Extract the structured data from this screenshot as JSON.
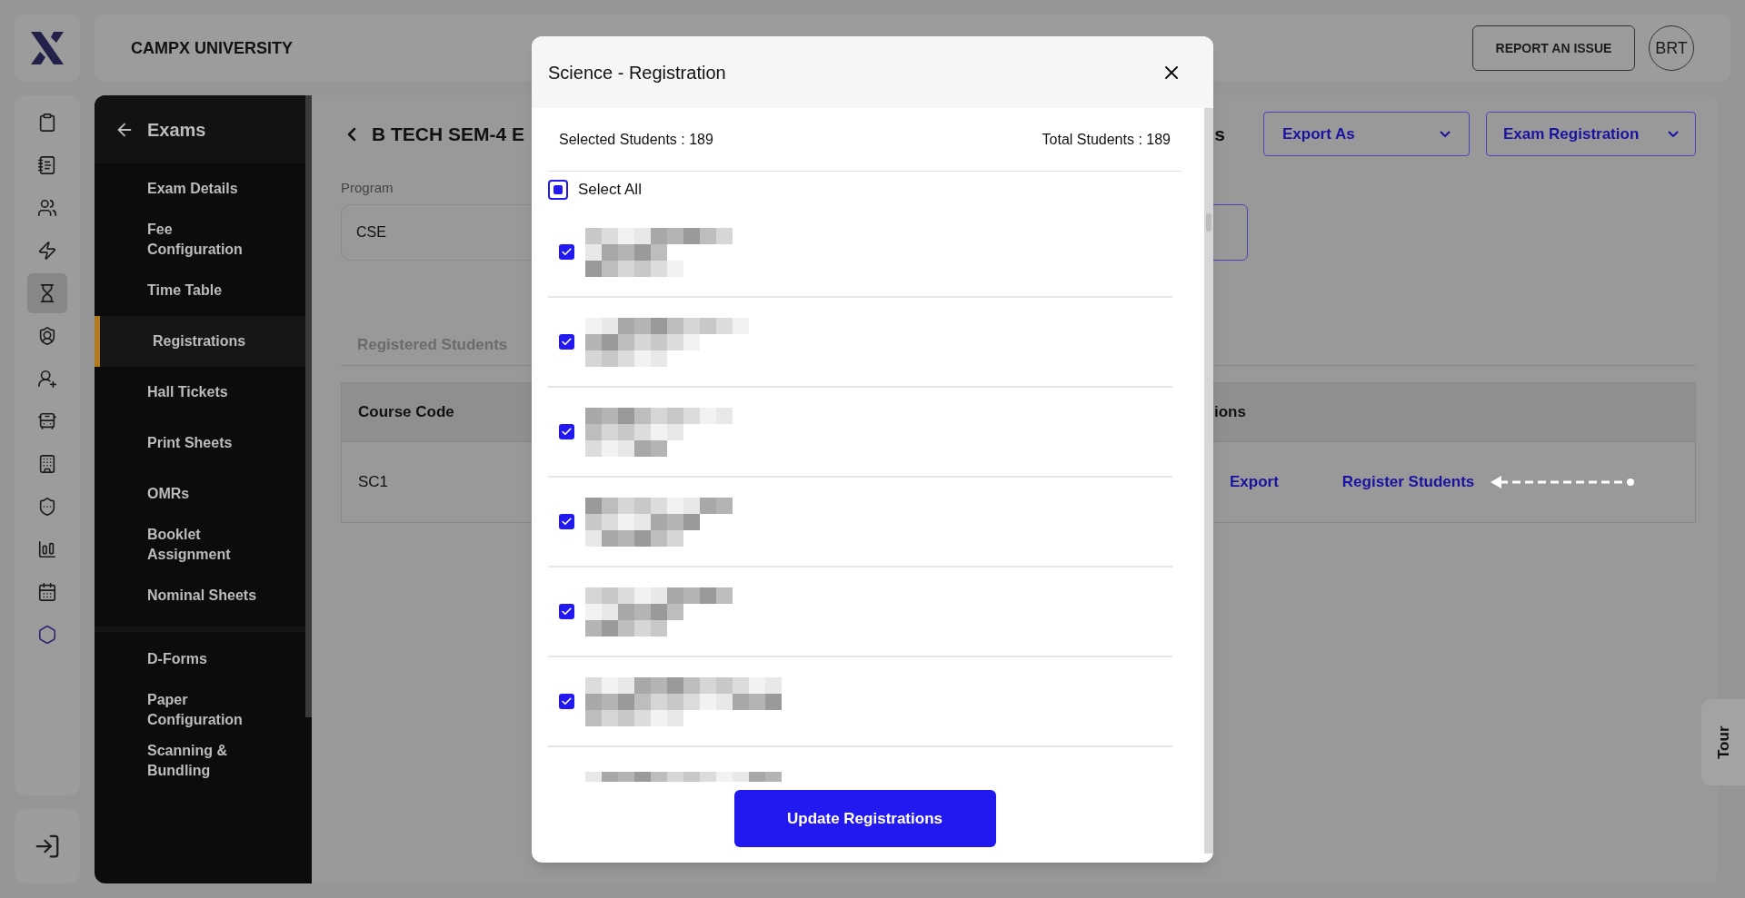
{
  "app": {
    "university": "CAMPX UNIVERSITY",
    "report_button": "REPORT AN ISSUE",
    "avatar": "BRT"
  },
  "rail": [
    {
      "selected": false,
      "color": "#1c1c1c"
    },
    {
      "selected": false,
      "color": "#1c1c1c"
    },
    {
      "selected": false,
      "color": "#1c1c1c"
    },
    {
      "selected": false,
      "color": "#1c1c1c"
    },
    {
      "selected": true,
      "color": "#1c1c1c"
    },
    {
      "selected": false,
      "color": "#1c1c1c"
    },
    {
      "selected": false,
      "color": "#1c1c1c"
    },
    {
      "selected": false,
      "color": "#1c1c1c"
    },
    {
      "selected": false,
      "color": "#1c1c1c"
    },
    {
      "selected": false,
      "color": "#1c1c1c"
    },
    {
      "selected": false,
      "color": "#1c1c1c"
    },
    {
      "selected": false,
      "color": "#1c1c1c"
    },
    {
      "selected": false,
      "color": "#2e2a6e"
    }
  ],
  "sidebar": {
    "title": "Exams",
    "sections": [
      {
        "items": [
          {
            "label": "Exam Details",
            "selected": false
          },
          {
            "label": "Fee Configuration",
            "selected": false
          },
          {
            "label": "Time Table",
            "selected": false
          },
          {
            "label": "Registrations",
            "selected": true
          },
          {
            "label": "Hall Tickets",
            "selected": false
          },
          {
            "label": "Print Sheets",
            "selected": false
          },
          {
            "label": "OMRs",
            "selected": false
          },
          {
            "label": "Booklet Assignment",
            "selected": false
          },
          {
            "label": "Nominal Sheets",
            "selected": false
          }
        ]
      },
      {
        "items": [
          {
            "label": "D-Forms",
            "selected": false
          },
          {
            "label": "Paper Configuration",
            "selected": false
          },
          {
            "label": "Scanning & Bundling",
            "selected": false
          }
        ]
      }
    ]
  },
  "page": {
    "title": "B TECH SEM-4 E",
    "title_end": "s",
    "export_menu": "Export As",
    "registration_menu": "Exam Registration",
    "program_label": "Program",
    "program_value": "CSE",
    "tabs": [
      {
        "label": "Registered Students",
        "selected": false
      }
    ],
    "table": {
      "columns": [
        "Course Code",
        "ions"
      ],
      "rows": [
        {
          "cells": [
            "SC1"
          ],
          "actions": [
            "Export",
            "Register Students"
          ]
        }
      ]
    }
  },
  "modal": {
    "title": "Science - Registration",
    "selected_count": "Selected Students : 189",
    "total_count": "Total Students : 189",
    "select_all": {
      "label": "Select All",
      "indeterminate": true
    },
    "students": [
      {
        "checked": true
      },
      {
        "checked": true
      },
      {
        "checked": true
      },
      {
        "checked": true
      },
      {
        "checked": true
      },
      {
        "checked": true
      }
    ],
    "button": "Update Registrations"
  },
  "tour": "Tour"
}
